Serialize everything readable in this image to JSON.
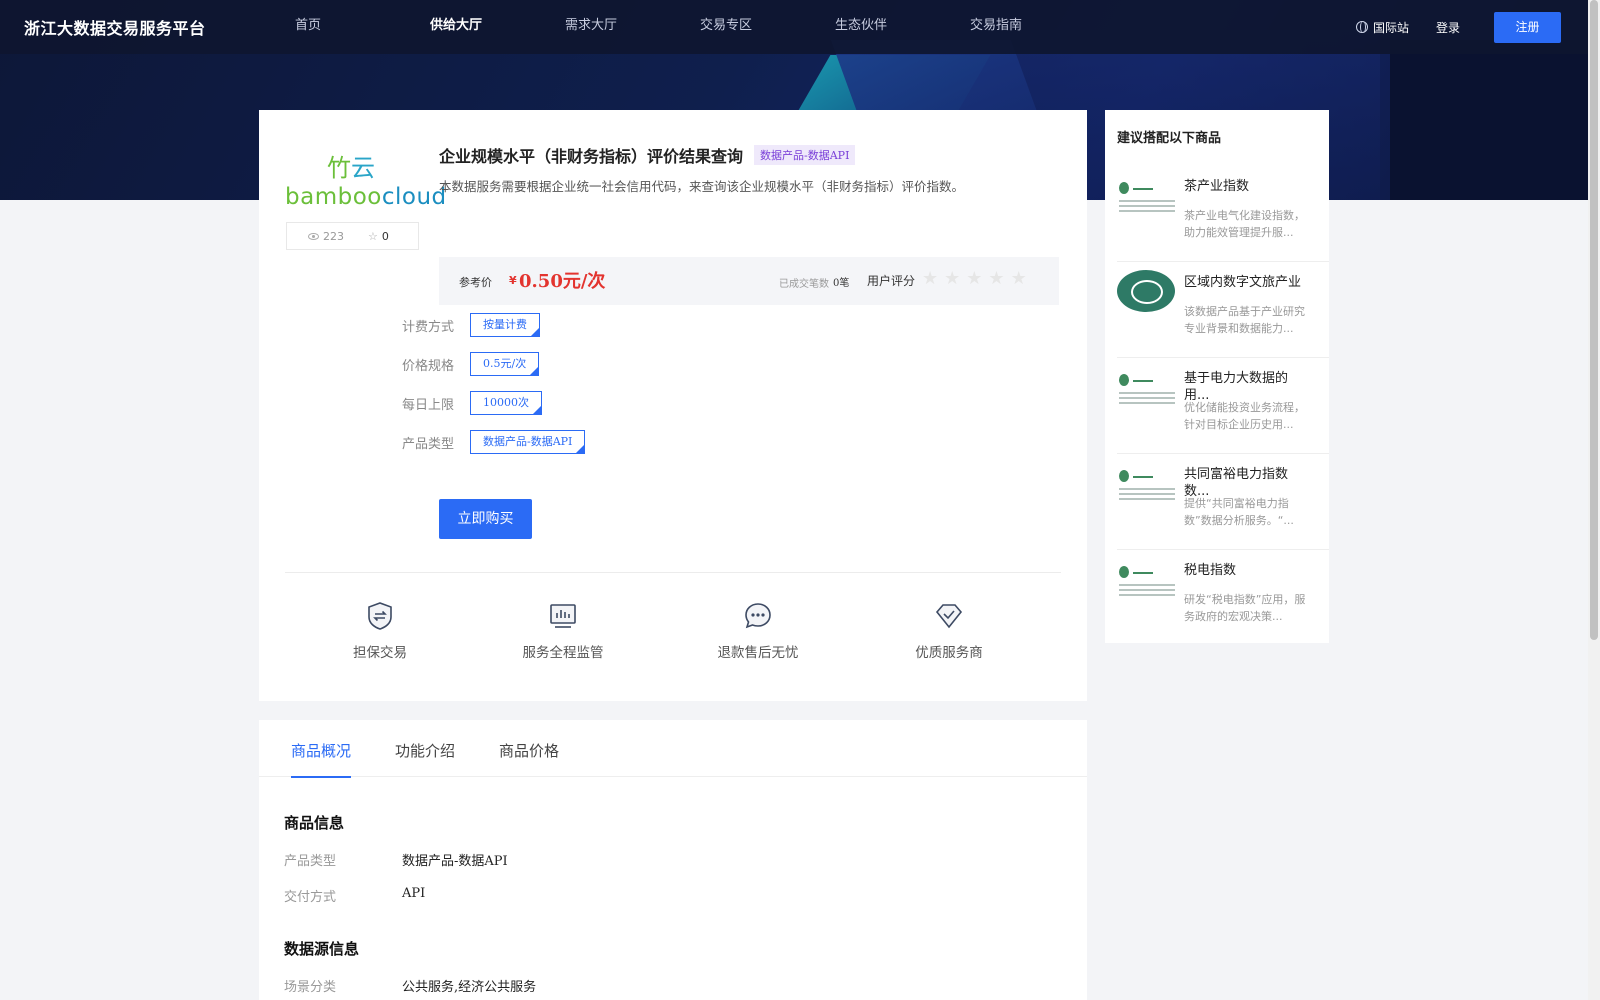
{
  "nav": {
    "brand": "浙江大数据交易服务平台",
    "items": [
      {
        "label": "首页",
        "active": false
      },
      {
        "label": "供给大厅",
        "active": true
      },
      {
        "label": "需求大厅",
        "active": false
      },
      {
        "label": "交易专区",
        "active": false
      },
      {
        "label": "生态伙伴",
        "active": false
      },
      {
        "label": "交易指南",
        "active": false
      }
    ],
    "intl_label": "国际站",
    "login_label": "登录",
    "register_label": "注册"
  },
  "product": {
    "logo_text_a": "bamboo",
    "logo_text_b": "cloud",
    "logo_mark_a": "竹",
    "logo_mark_b": "云",
    "views": "223",
    "favorites": "0",
    "title": "企业规模水平（非财务指标）评价结果查询",
    "type_tag": "数据产品-数据API",
    "description": "本数据服务需要根据企业统一社会信用代码，来查询该企业规模水平（非财务指标）评价指数。",
    "price_label": "参考价",
    "price_currency": "¥",
    "price_value": "0.50元/次",
    "deals_label": "已成交笔数",
    "deals_value": "0笔",
    "rating_label": "用户评分",
    "rating": 0,
    "specs": [
      {
        "label": "计费方式",
        "value": "按量计费"
      },
      {
        "label": "价格规格",
        "value": "0.5元/次"
      },
      {
        "label": "每日上限",
        "value": "10000次"
      },
      {
        "label": "产品类型",
        "value": "数据产品-数据API"
      }
    ],
    "buy_label": "立即购买",
    "features": [
      {
        "label": "担保交易",
        "icon": "shield-icon"
      },
      {
        "label": "服务全程监管",
        "icon": "monitor-icon"
      },
      {
        "label": "退款售后无忧",
        "icon": "chat-icon"
      },
      {
        "label": "优质服务商",
        "icon": "diamond-icon"
      }
    ]
  },
  "recommendations": {
    "title": "建议搭配以下商品",
    "items": [
      {
        "name": "茶产业指数",
        "desc": "茶产业电气化建设指数，助力能效管理提升服...",
        "thumb": "state-grid-logo"
      },
      {
        "name": "区域内数字文旅产业",
        "desc": "该数据产品基于产业研究专业背景和数据能力...",
        "thumb": "round-logo"
      },
      {
        "name": "基于电力大数据的用...",
        "desc": "优化储能投资业务流程，针对目标企业历史用...",
        "thumb": "state-grid-logo"
      },
      {
        "name": "共同富裕电力指数数...",
        "desc": "提供“共同富裕电力指数”数据分析服务。“...",
        "thumb": "state-grid-logo"
      },
      {
        "name": "税电指数",
        "desc": "研发“税电指数”应用，服务政府的宏观决策...",
        "thumb": "state-grid-logo"
      }
    ]
  },
  "details": {
    "tabs": [
      {
        "label": "商品概况",
        "active": true
      },
      {
        "label": "功能介绍",
        "active": false
      },
      {
        "label": "商品价格",
        "active": false
      }
    ],
    "section1_title": "商品信息",
    "section1_rows": [
      {
        "key": "产品类型",
        "value": "数据产品-数据API"
      },
      {
        "key": "交付方式",
        "value": "API"
      }
    ],
    "section2_title": "数据源信息",
    "section2_rows": [
      {
        "key": "场景分类",
        "value": "公共服务,经济公共服务"
      }
    ]
  }
}
